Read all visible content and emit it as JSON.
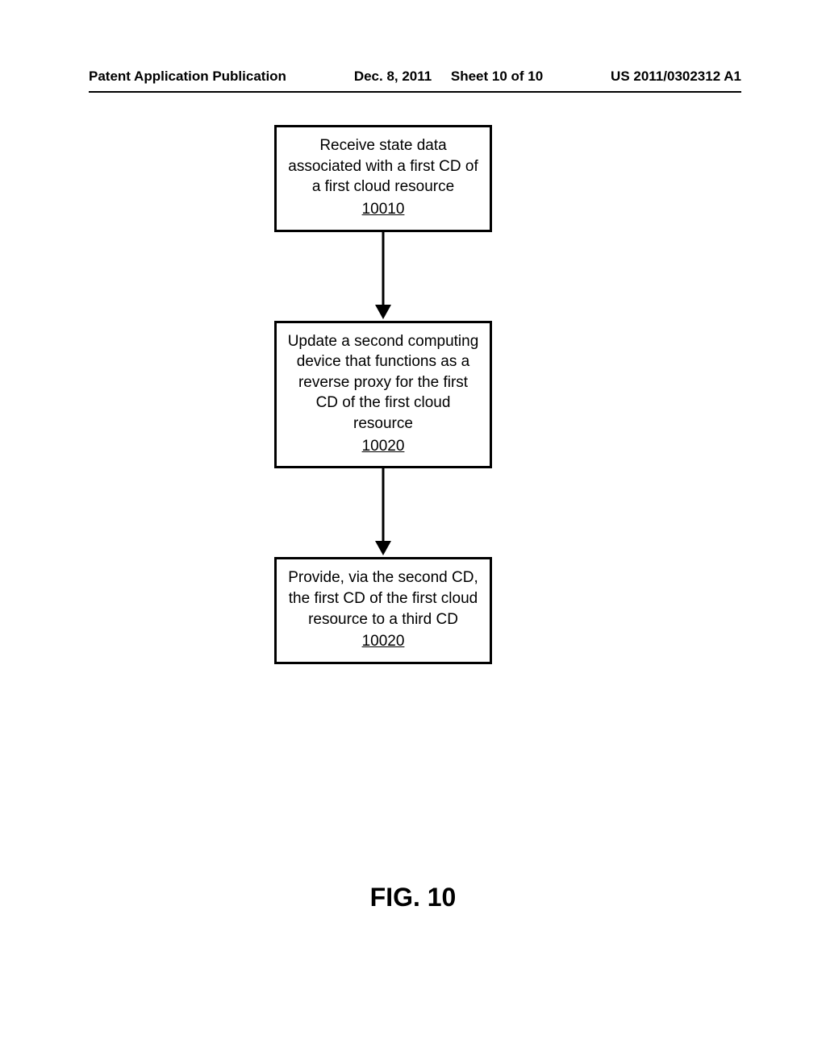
{
  "header": {
    "publication_label": "Patent Application Publication",
    "date": "Dec. 8, 2011",
    "sheet_label": "Sheet 10 of 10",
    "pub_number": "US 2011/0302312 A1"
  },
  "flowchart": {
    "box1": {
      "text": "Receive state data associated with a first CD of a first cloud resource",
      "ref": "10010"
    },
    "box2": {
      "text": "Update a second computing device that functions as a reverse proxy for the first CD of the first cloud resource",
      "ref": "10020"
    },
    "box3": {
      "text": "Provide, via the second CD, the first CD of the first cloud resource to a third CD",
      "ref": "10020"
    }
  },
  "figure_label": "FIG. 10",
  "chart_data": {
    "type": "flowchart",
    "nodes": [
      {
        "id": "10010",
        "label": "Receive state data associated with a first CD of a first cloud resource"
      },
      {
        "id": "10020",
        "label": "Update a second computing device that functions as a reverse proxy for the first CD of the first cloud resource"
      },
      {
        "id": "10020b",
        "label": "Provide, via the second CD, the first CD of the first cloud resource to a third CD"
      }
    ],
    "edges": [
      {
        "from": "10010",
        "to": "10020"
      },
      {
        "from": "10020",
        "to": "10020b"
      }
    ]
  }
}
